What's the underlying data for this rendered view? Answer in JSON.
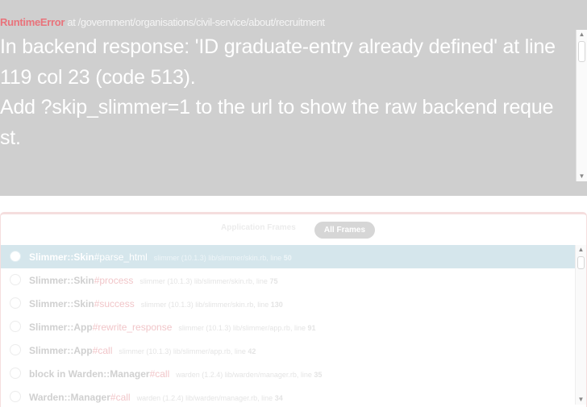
{
  "error": {
    "type": "RuntimeError",
    "location": " at /government/organisations/civil-service/about/recruitment",
    "message_lines": [
      "In backend response: 'ID graduate-entry already defined' at line",
      "119 col 23 (code 513).",
      "Add ?skip_slimmer=1 to the url to show the raw backend reque",
      "st."
    ]
  },
  "tabs": {
    "application_frames": "Application Frames",
    "all_frames": "All Frames"
  },
  "frames": [
    {
      "cls": "Slimmer::Skin",
      "method": "#parse_html",
      "location": "slimmer (10.1.3) lib/slimmer/skin.rb, line ",
      "line": "50"
    },
    {
      "cls": "Slimmer::Skin",
      "method": "#process",
      "location": "slimmer (10.1.3) lib/slimmer/skin.rb, line ",
      "line": "75"
    },
    {
      "cls": "Slimmer::Skin",
      "method": "#success",
      "location": "slimmer (10.1.3) lib/slimmer/skin.rb, line ",
      "line": "130"
    },
    {
      "cls": "Slimmer::App",
      "method": "#rewrite_response",
      "location": "slimmer (10.1.3) lib/slimmer/app.rb, line ",
      "line": "91"
    },
    {
      "cls": "Slimmer::App",
      "method": "#call",
      "location": "slimmer (10.1.3) lib/slimmer/app.rb, line ",
      "line": "42"
    },
    {
      "cls": "block in Warden::Manager",
      "method": "#call",
      "location": "warden (1.2.4) lib/warden/manager.rb, line ",
      "line": "35"
    },
    {
      "cls": "Warden::Manager",
      "method": "#call",
      "location": "warden (1.2.4) lib/warden/manager.rb, line ",
      "line": "34"
    }
  ],
  "icons": {
    "scroll_up": "▲",
    "scroll_down": "▼"
  },
  "colors": {
    "header_bg": "#cfcfcf",
    "error_type": "#e9737b",
    "selected_row": "#d5e6ec",
    "method": "#f1c6c9"
  }
}
